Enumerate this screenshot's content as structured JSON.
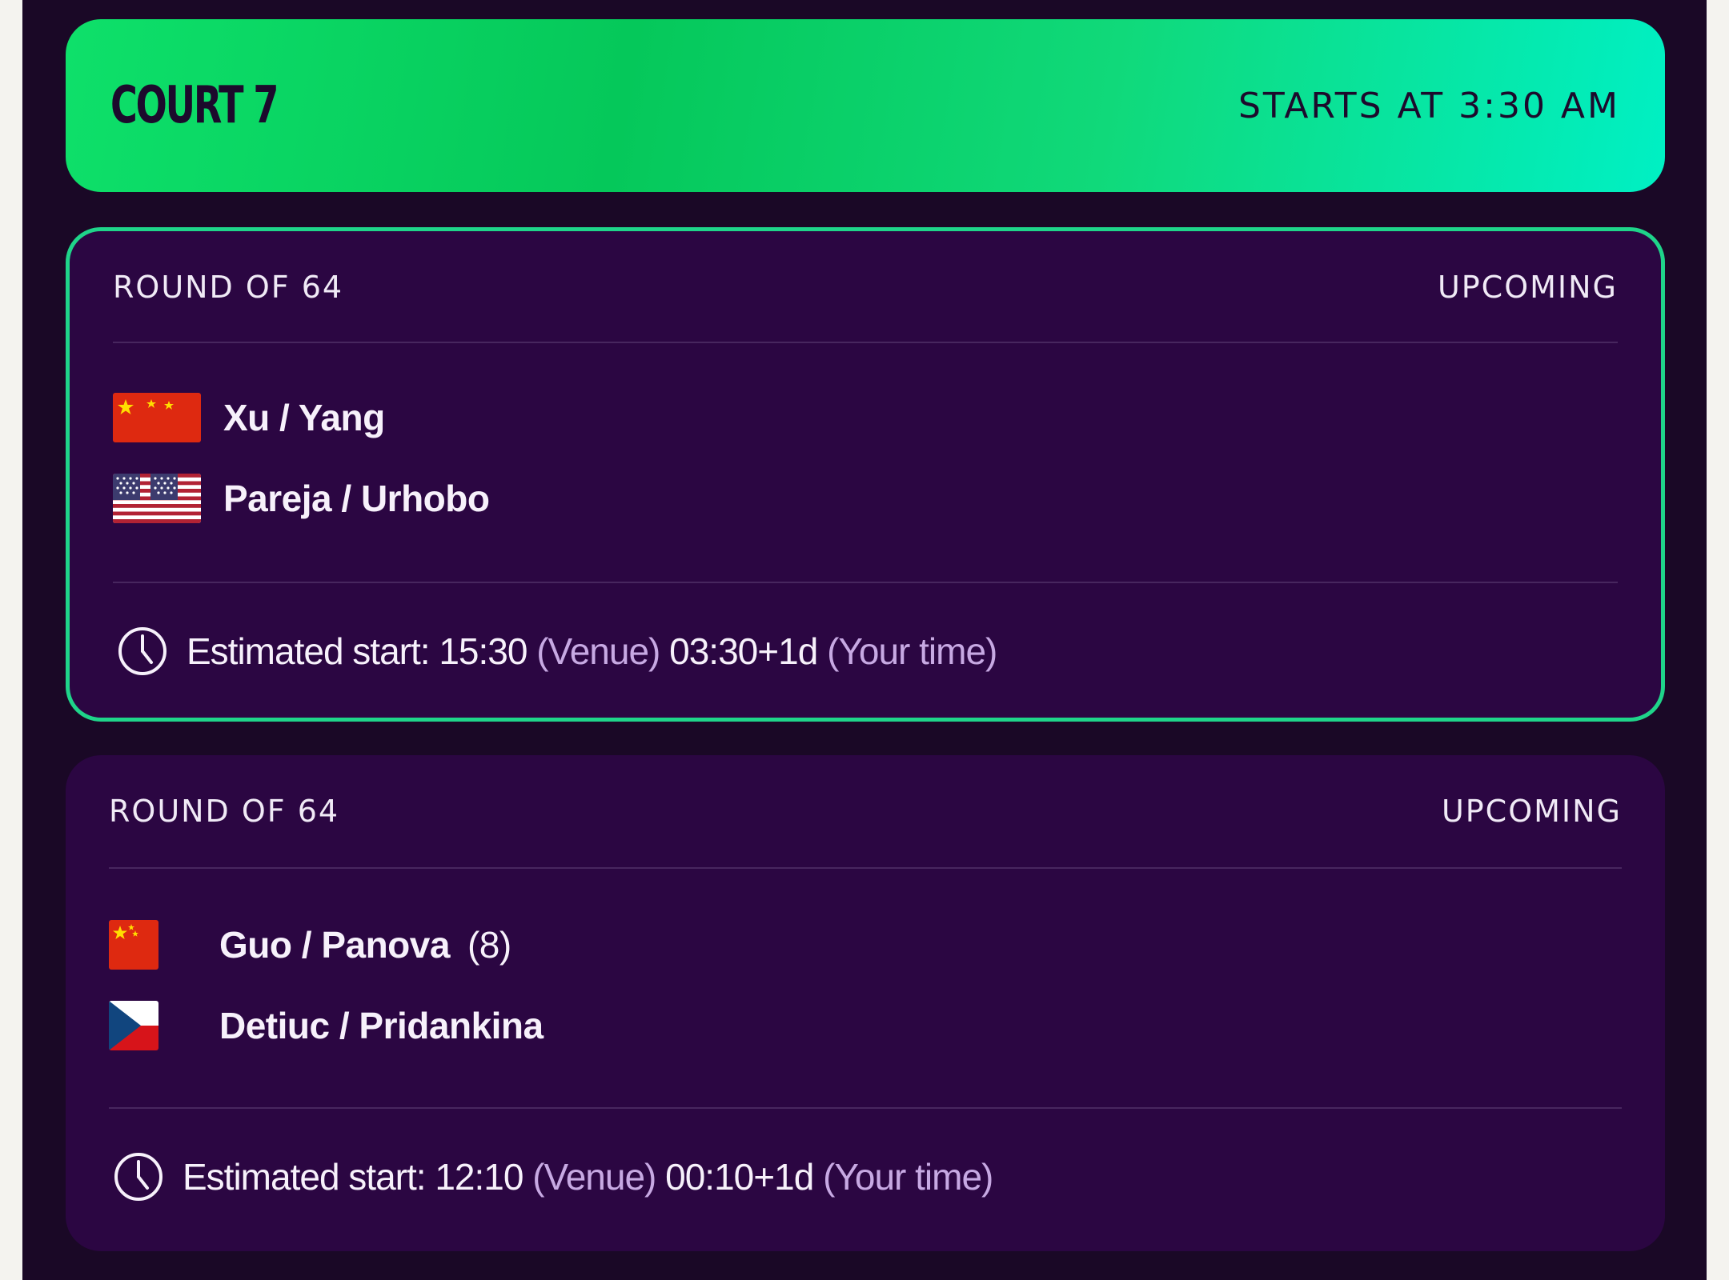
{
  "court": {
    "title": "COURT 7",
    "start_label": "STARTS AT 3:30 AM"
  },
  "colors": {
    "header_gradient_start": "#05c85a",
    "header_gradient_end": "#00f0c4",
    "card_background": "#2b0642",
    "active_border": "#1fd48a",
    "muted_text": "#c7a9e3"
  },
  "matches": [
    {
      "round": "ROUND OF 64",
      "status": "UPCOMING",
      "highlighted": true,
      "teams": [
        {
          "flag": "china-flag",
          "name": "Xu / Yang",
          "seed": ""
        },
        {
          "flag": "usa-flag",
          "name": "Pareja / Urhobo",
          "seed": ""
        }
      ],
      "estimate": {
        "prefix": "Estimated start: 15:30",
        "venue_label": "(Venue)",
        "local_time": "03:30+1d",
        "local_label": "(Your time)"
      }
    },
    {
      "round": "ROUND OF 64",
      "status": "UPCOMING",
      "highlighted": false,
      "teams": [
        {
          "flag": "china-flag",
          "name": "Guo / Panova",
          "seed": "(8)"
        },
        {
          "flag": "czech-flag",
          "name": "Detiuc / Pridankina",
          "seed": ""
        }
      ],
      "estimate": {
        "prefix": "Estimated start: 12:10",
        "venue_label": "(Venue)",
        "local_time": "00:10+1d",
        "local_label": "(Your time)"
      }
    }
  ]
}
